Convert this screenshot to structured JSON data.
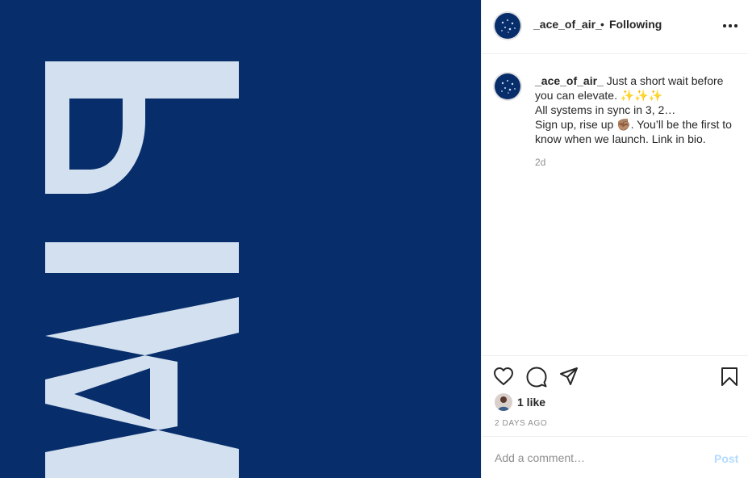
{
  "media": {
    "word": "AIR",
    "background_color": "#072e6b",
    "letter_color": "#d3e0f0"
  },
  "header": {
    "username": "_ace_of_air_",
    "separator": "•",
    "follow_status": "Following",
    "more_icon": "more-horizontal-icon"
  },
  "caption": {
    "username": "_ace_of_air_",
    "line1": " Just a short wait before you can elevate. ✨✨✨",
    "line2": "All systems in sync in 3, 2…",
    "line3": "Sign up, rise up ✊🏽. You’ll be the first to know when we launch. Link in bio.",
    "time": "2d"
  },
  "actions": {
    "like_icon": "heart-icon",
    "comment_icon": "comment-bubble-icon",
    "share_icon": "paper-plane-icon",
    "save_icon": "bookmark-icon",
    "likes_text": "1 like",
    "posted_ago": "2 DAYS AGO"
  },
  "comment_box": {
    "placeholder": "Add a comment…",
    "post_label": "Post",
    "post_color": "#b3dbff"
  }
}
